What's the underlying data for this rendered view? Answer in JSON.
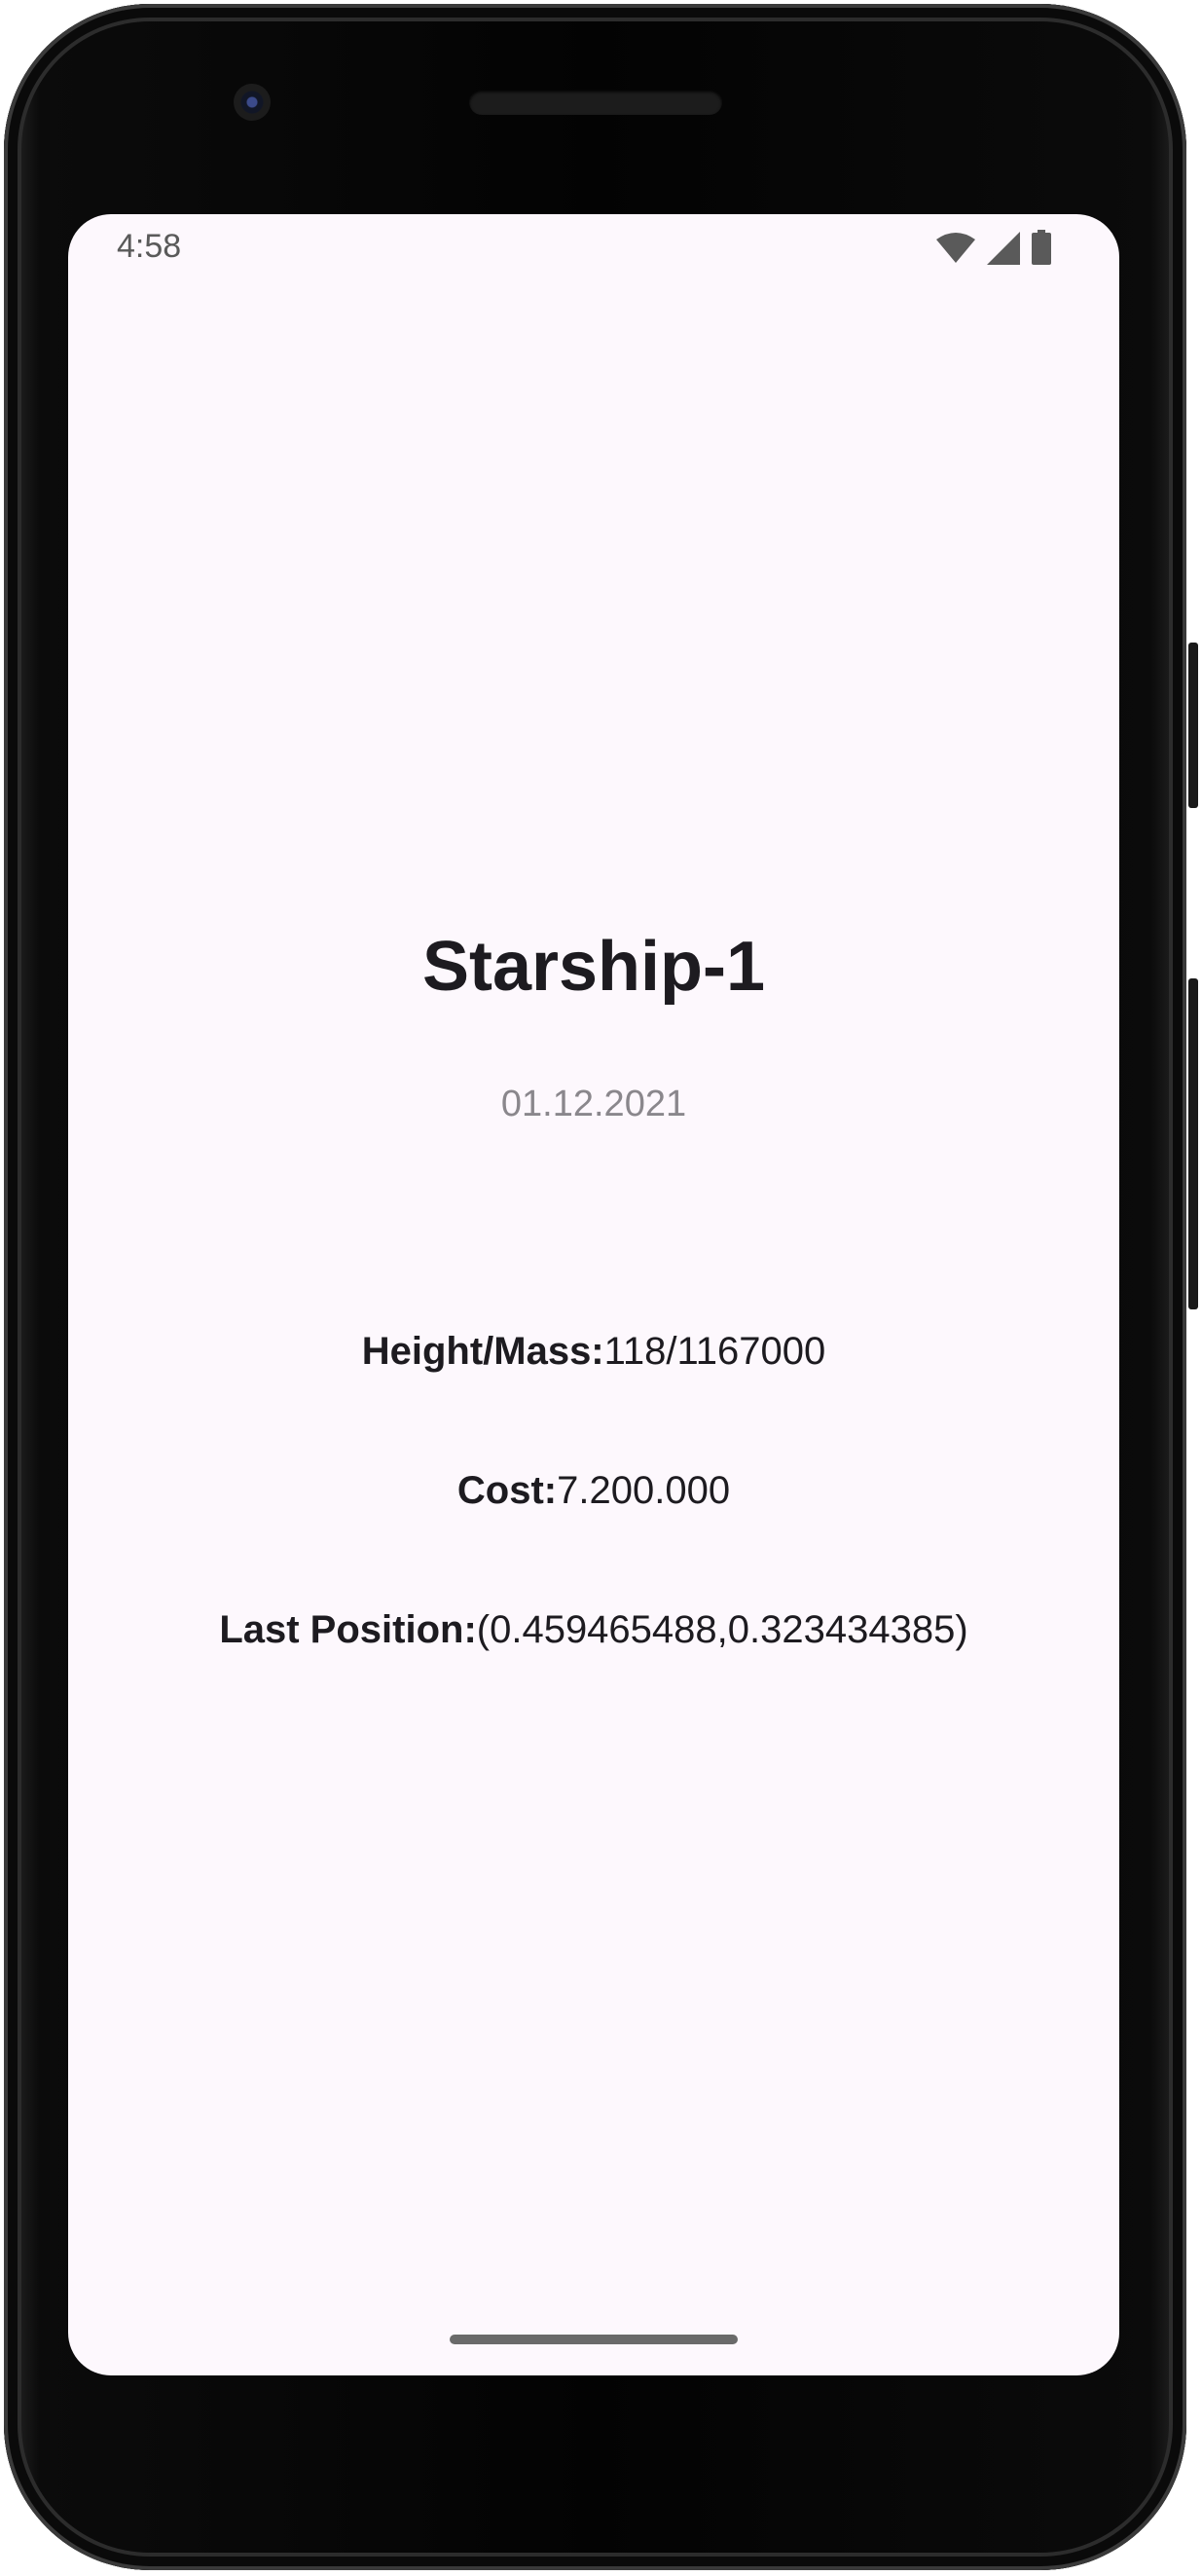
{
  "status_bar": {
    "time": "4:58",
    "icons": [
      "wifi-icon",
      "signal-icon",
      "battery-icon"
    ]
  },
  "starship": {
    "name": "Starship-1",
    "date": "01.12.2021",
    "height_mass_label": "Height/Mass:",
    "height_mass_value": "118/1167000",
    "cost_label": "Cost:",
    "cost_value": "7.200.000",
    "position_label": "Last Position:",
    "position_value": "(0.459465488,0.323434385)"
  },
  "colors": {
    "screen_background": "#fdf8fd",
    "text_primary": "#1d1b20",
    "text_secondary": "#8a878c"
  }
}
